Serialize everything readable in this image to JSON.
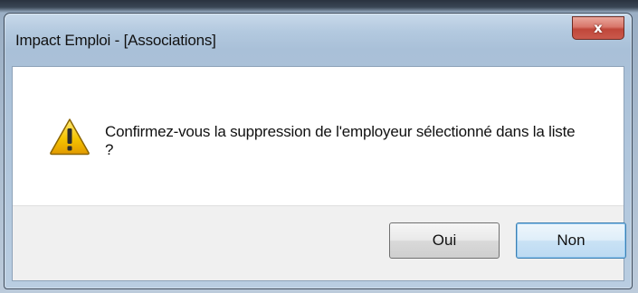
{
  "window": {
    "title": "Impact Emploi - [Associations]",
    "close_label": "x"
  },
  "dialog": {
    "icon": "warning-icon",
    "message_line1": "Confirmez-vous la suppression de l'employeur sélectionné dans la liste",
    "message_line2": "?"
  },
  "buttons": {
    "yes_label": "Oui",
    "no_label": "Non"
  },
  "colors": {
    "warning_yellow": "#f2c200",
    "close_red": "#c9594c",
    "default_button_border": "#3c7fb1"
  }
}
